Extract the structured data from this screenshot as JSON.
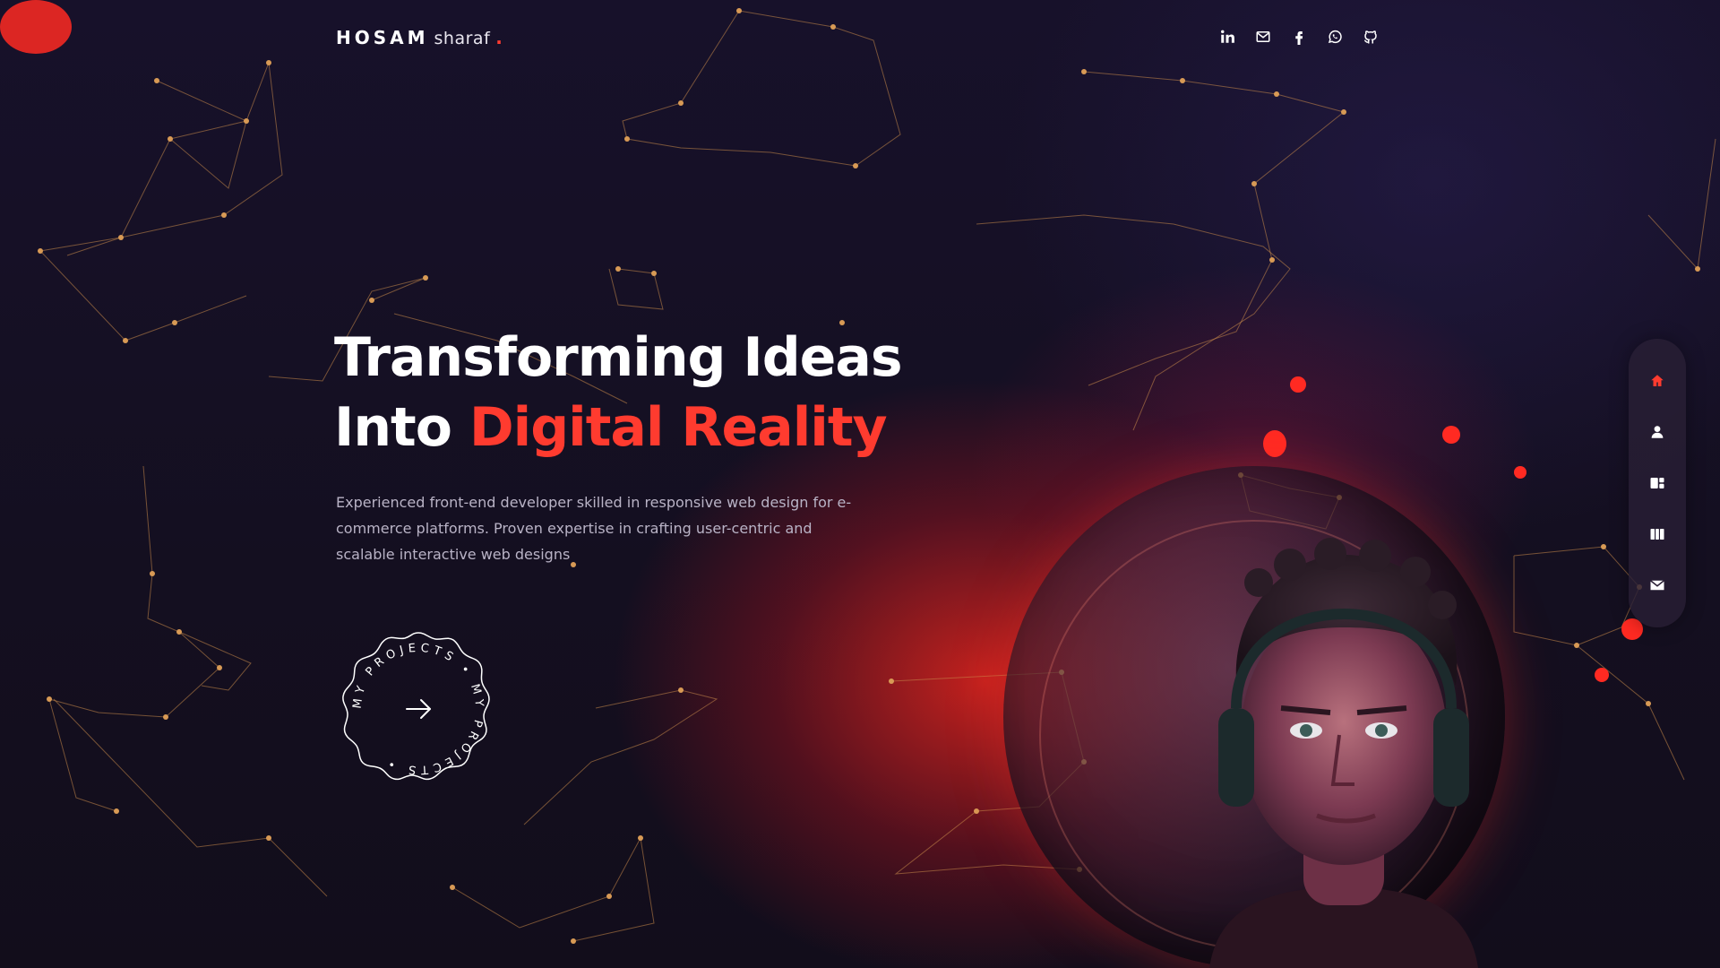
{
  "header": {
    "logo_strong": "HOSAM",
    "logo_light": "sharaf",
    "logo_dot": ".",
    "socials": [
      {
        "icon": "linkedin-icon"
      },
      {
        "icon": "mail-icon"
      },
      {
        "icon": "facebook-icon"
      },
      {
        "icon": "whatsapp-icon"
      },
      {
        "icon": "github-icon"
      }
    ]
  },
  "hero": {
    "title_line1": "Transforming Ideas",
    "title_line2_plain": "Into ",
    "title_line2_accent": "Digital Reality",
    "description": "Experienced front-end developer skilled in responsive web design for e-commerce platforms. Proven expertise in crafting user-centric and scalable interactive web designs",
    "badge_text": "MY PROJECTS • MY PROJECTS • "
  },
  "side_nav": {
    "items": [
      {
        "icon": "home-icon",
        "active": true
      },
      {
        "icon": "user-icon",
        "active": false
      },
      {
        "icon": "services-icon",
        "active": false
      },
      {
        "icon": "portfolio-icon",
        "active": false
      },
      {
        "icon": "contact-icon",
        "active": false
      }
    ]
  },
  "colors": {
    "accent": "#ff3b2f",
    "background": "#15101f",
    "network_line": "#c98a4a",
    "nav_icon": "#ffffff"
  }
}
